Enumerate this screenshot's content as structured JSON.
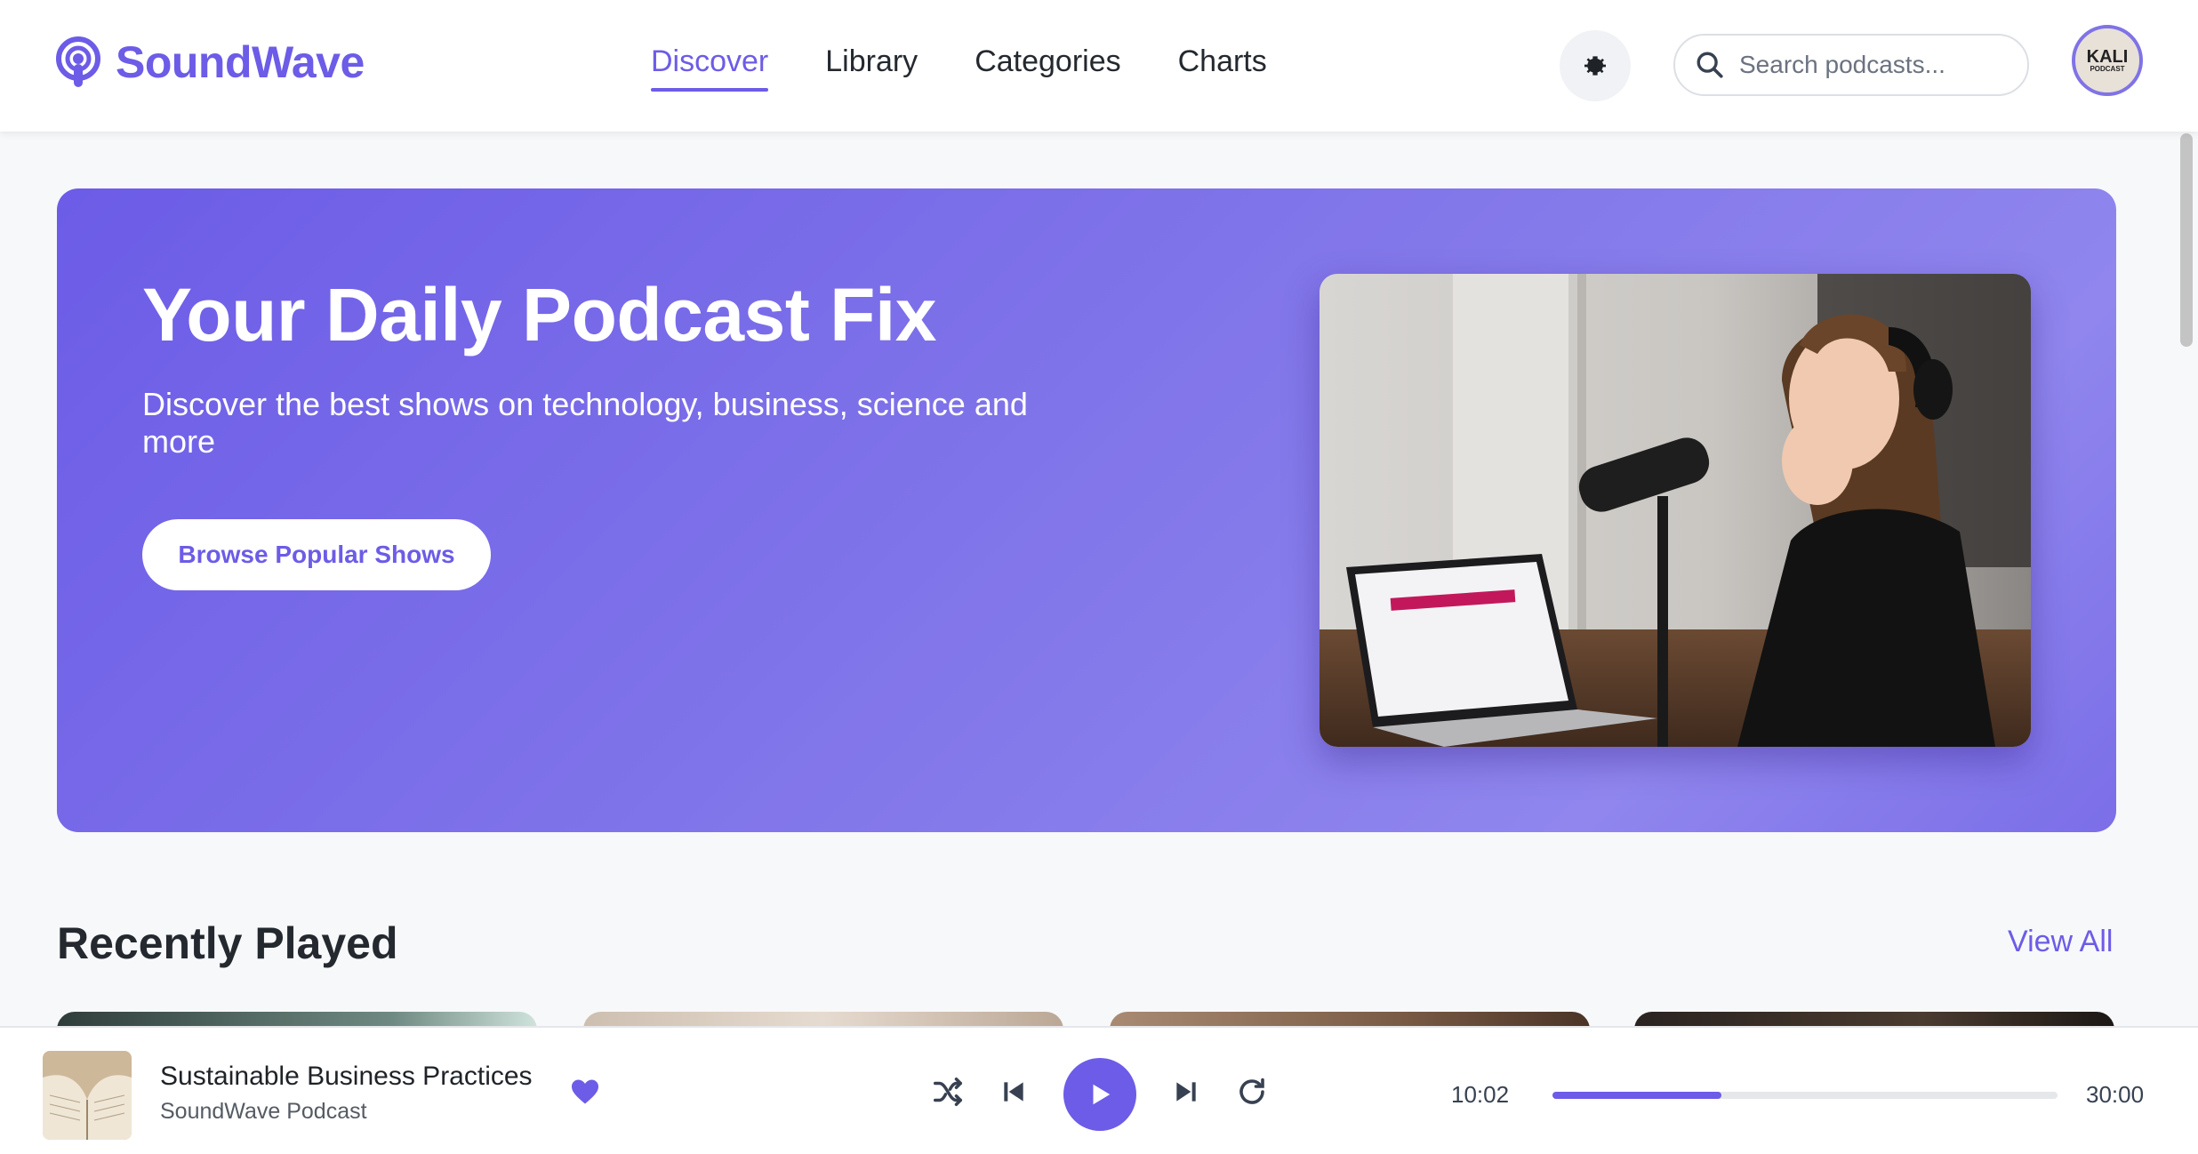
{
  "brand": {
    "name": "SoundWave"
  },
  "nav": {
    "items": [
      {
        "label": "Discover",
        "active": true
      },
      {
        "label": "Library",
        "active": false
      },
      {
        "label": "Categories",
        "active": false
      },
      {
        "label": "Charts",
        "active": false
      }
    ]
  },
  "header": {
    "theme_icon": "gear-icon",
    "search_placeholder": "Search podcasts...",
    "avatar_text": "KALI",
    "avatar_sub": "PODCAST"
  },
  "hero": {
    "title": "Your Daily Podcast Fix",
    "subtitle": "Discover the best shows on technology, business, science and more",
    "button_label": "Browse Popular Shows"
  },
  "recently_played": {
    "title": "Recently Played",
    "view_all_label": "View All"
  },
  "player": {
    "track_title": "Sustainable Business Practices",
    "track_artist": "SoundWave Podcast",
    "elapsed": "10:02",
    "duration": "30:00",
    "progress_fraction": 0.334,
    "liked": true
  },
  "colors": {
    "accent": "#6c5ce7",
    "hero_gradient_start": "#6c5ce7",
    "hero_gradient_end": "#9086ee"
  }
}
